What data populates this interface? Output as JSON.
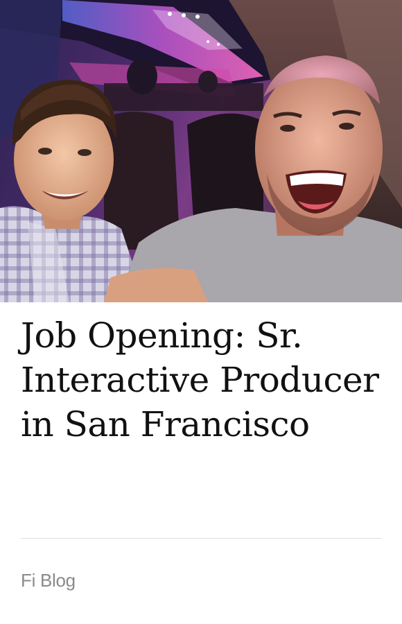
{
  "article": {
    "image_alt": "Two men smiling in a selfie on an airplane",
    "title": "Job Opening: Sr. Interactive Producer in San Francisco",
    "source": "Fi Blog"
  },
  "colors": {
    "title_text": "#111111",
    "source_text": "#8a8a8a",
    "divider": "#dcdcdc",
    "cabin_light": "#e04fb8"
  }
}
